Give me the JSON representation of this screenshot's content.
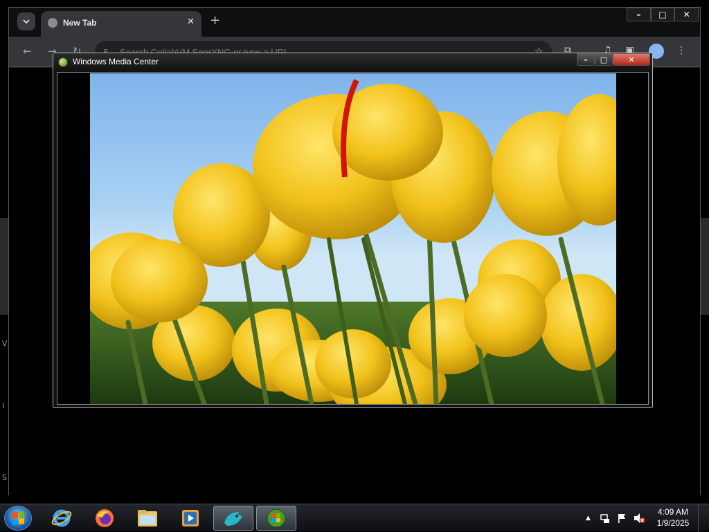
{
  "browser": {
    "tab_title": "New Tab",
    "tab_close": "✕",
    "new_tab": "+",
    "omnibox_placeholder": "Search CollabVM SearXNG or type a URL",
    "window_controls": {
      "minimize": "–",
      "maximize": "□",
      "close": "✕"
    }
  },
  "wmc": {
    "title": "Windows Media Center",
    "controls": {
      "minimize": "–",
      "maximize": "□",
      "close": "✕"
    }
  },
  "taskbar": {
    "apps": [
      "start-orb",
      "internet-explorer",
      "firefox",
      "windows-explorer",
      "windows-media-player",
      "remote-desktop",
      "windows-media-center"
    ],
    "active_app": "windows-media-center",
    "tray_icons": [
      "show-hidden-icons",
      "network-icon",
      "action-center-flag-icon",
      "volume-muted-icon"
    ],
    "tray_arrow": "▲",
    "time": "4:09 AM",
    "date": "1/9/2025"
  },
  "desktop_fragments": [
    "V",
    "I",
    "S"
  ],
  "colors": {
    "chrome_bg": "#202124",
    "tab_bg": "#35363a",
    "wmc_close": "#c4382a",
    "tulip_yellow": "#f2c21b",
    "sky_blue": "#8cc0ee"
  }
}
